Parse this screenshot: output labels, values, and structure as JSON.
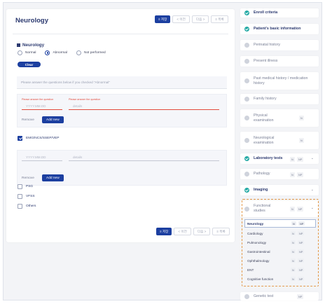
{
  "page": {
    "title": "Neurology"
  },
  "toolbar": {
    "save": "≡ 저장",
    "prev": "< 이전",
    "next": "다음 >",
    "list": "≡ 목록"
  },
  "section": {
    "title": "Neurology",
    "options": [
      "Normal",
      "Abnormal",
      "Not performed"
    ],
    "selected": "Abnormal",
    "clear": "Clear",
    "note": "Please answer the questions below if you checked \"Abnormal\""
  },
  "entry1": {
    "label_date": "Please answer the question",
    "label_details": "Please answer the question",
    "date_placeholder": "YYYY.MM.DD",
    "details_placeholder": "details",
    "remove": "Remove",
    "add": "Add new"
  },
  "checks": [
    {
      "label": "EMG/NCS/SSEP/VEP",
      "checked": true
    },
    {
      "label": "PSG",
      "checked": false
    },
    {
      "label": "VFSS",
      "checked": false
    },
    {
      "label": "Others",
      "checked": false
    }
  ],
  "entry2": {
    "date_placeholder": "YYYY.MM.DD",
    "details_placeholder": "details",
    "remove": "Remove",
    "add": "Add new"
  },
  "sidebar": {
    "items": [
      {
        "label": "Enroll criteria",
        "done": true
      },
      {
        "label": "Patient's basic information",
        "done": true
      },
      {
        "label": "Perinatal history",
        "done": false
      },
      {
        "label": "Present illness",
        "done": false
      },
      {
        "label": "Past medical history / medication history",
        "done": false
      },
      {
        "label": "Family history",
        "done": false
      },
      {
        "label": "Physical examination",
        "done": false,
        "tags": [
          "N"
        ]
      },
      {
        "label": "Neurological examination",
        "done": false,
        "tags": [
          "N"
        ]
      },
      {
        "label": "Laboratory tests",
        "done": true,
        "tags": [
          "N",
          "NP"
        ]
      },
      {
        "label": "Pathology",
        "done": false,
        "tags": [
          "N",
          "NP"
        ]
      },
      {
        "label": "Imaging",
        "done": true
      },
      {
        "label": "Functional studies",
        "done": false,
        "tags": [
          "N",
          "NP"
        ]
      },
      {
        "label": "Genetic test",
        "done": false,
        "tags": [
          "NP"
        ]
      }
    ],
    "subitems": [
      {
        "label": "Neurology",
        "tags": [
          "N",
          "NP"
        ]
      },
      {
        "label": "Cardiology",
        "tags": [
          "N",
          "NP"
        ]
      },
      {
        "label": "Pulmonology",
        "tags": [
          "N",
          "NP"
        ]
      },
      {
        "label": "Gastrointestinal",
        "tags": [
          "N",
          "NP"
        ]
      },
      {
        "label": "Ophthalmology",
        "tags": [
          "N",
          "NP"
        ]
      },
      {
        "label": "ENT",
        "tags": [
          "N",
          "NP"
        ]
      },
      {
        "label": "Cognitive function",
        "tags": [
          "N",
          "NP"
        ]
      }
    ]
  },
  "colors": {
    "primary": "#1c3fa0",
    "done": "#22a9a4",
    "required": "#e24b3d",
    "highlight_border": "#e39a4c"
  }
}
